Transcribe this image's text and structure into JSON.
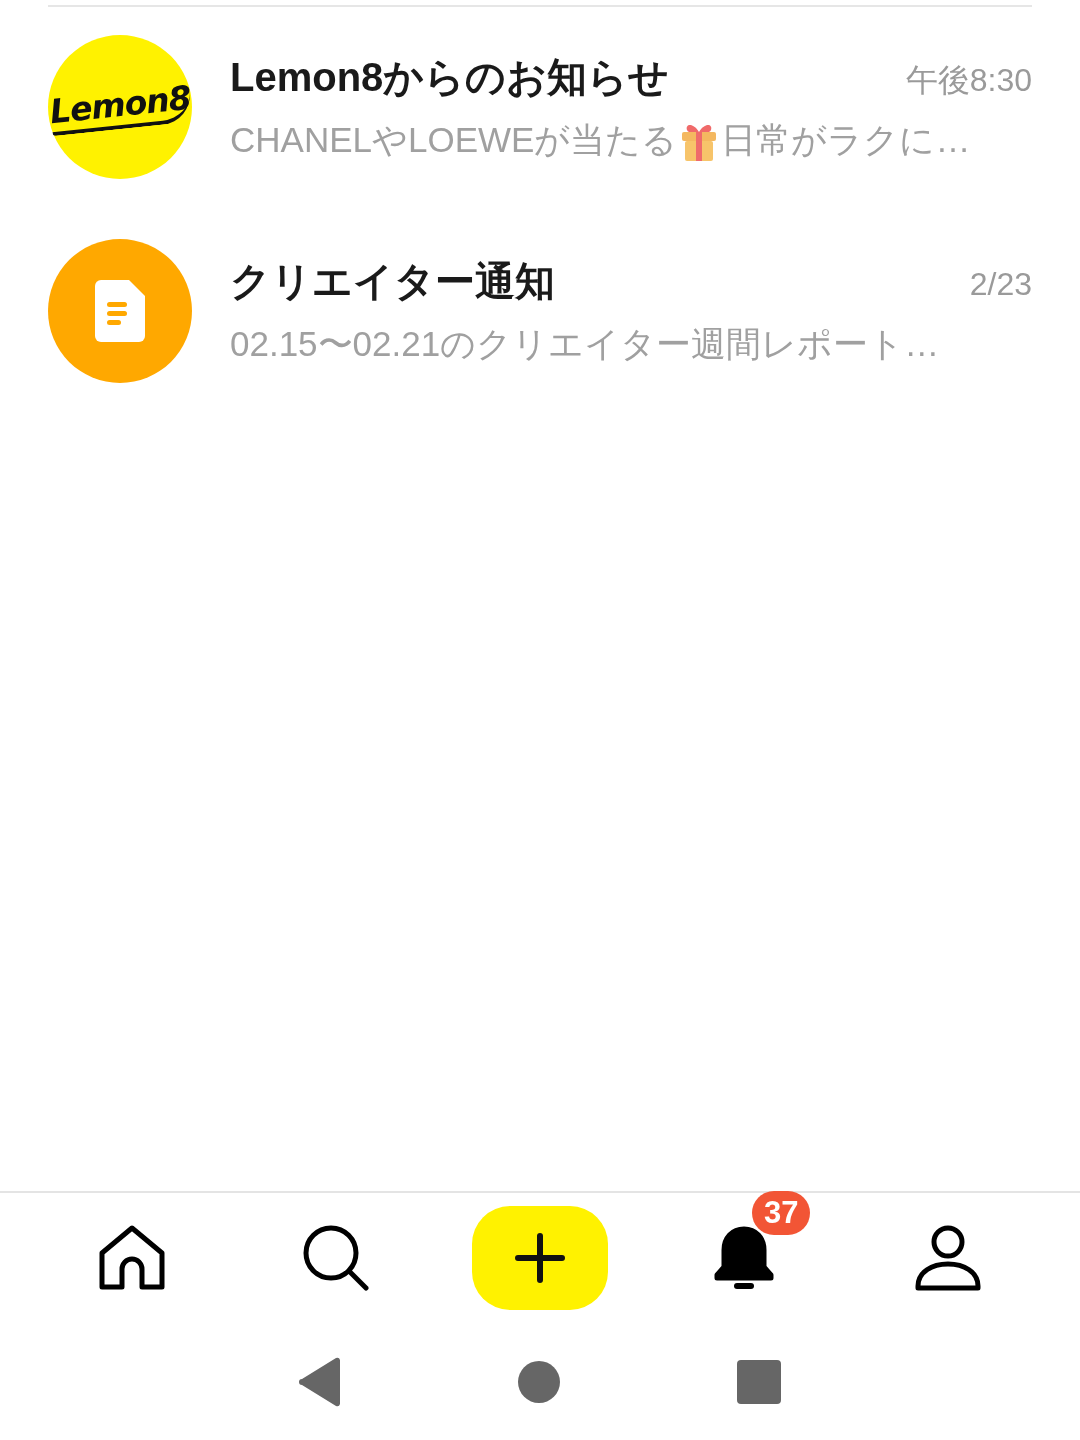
{
  "notifications": [
    {
      "avatar": {
        "kind": "logo",
        "text": "Lemon8"
      },
      "title": "Lemon8からのお知らせ",
      "time": "午後8:30",
      "preview": [
        {
          "kind": "text",
          "text": "CHANELやLOEWEが当たる"
        },
        {
          "kind": "gift"
        },
        {
          "kind": "text",
          "text": "日常がラクに…"
        }
      ]
    },
    {
      "avatar": {
        "kind": "document"
      },
      "title": "クリエイター通知",
      "time": "2/23",
      "preview": [
        {
          "kind": "text",
          "text": "02.15〜02.21のクリエイター週間レポート…"
        }
      ]
    }
  ],
  "tab_bar": [
    {
      "kind": "home",
      "selected": false
    },
    {
      "kind": "search",
      "selected": false
    },
    {
      "kind": "create",
      "selected": false
    },
    {
      "kind": "notifications",
      "selected": true,
      "badge": "37"
    },
    {
      "kind": "profile",
      "selected": false
    }
  ],
  "system_nav": [
    {
      "kind": "back"
    },
    {
      "kind": "home"
    },
    {
      "kind": "recents"
    }
  ]
}
